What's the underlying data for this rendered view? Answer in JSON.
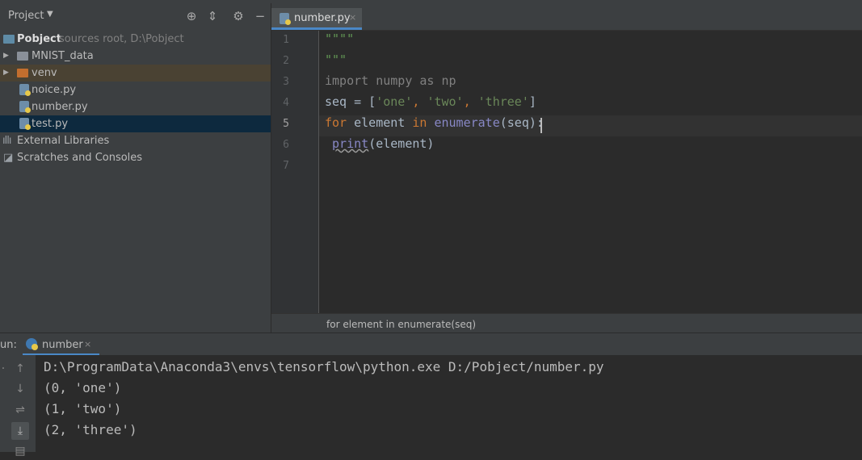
{
  "project_panel": {
    "title": "Project",
    "dropdown": "▼",
    "tree": [
      {
        "label": "Pobject",
        "hint": "sources root,  D:\\Pobject"
      },
      {
        "label": "MNIST_data"
      },
      {
        "label": "venv"
      },
      {
        "label": "noice.py"
      },
      {
        "label": "number.py"
      },
      {
        "label": "test.py"
      },
      {
        "label": "External Libraries"
      },
      {
        "label": "Scratches and Consoles"
      }
    ]
  },
  "editor": {
    "tab": {
      "label": "number.py",
      "close": "×"
    },
    "line_numbers": [
      "1",
      "2",
      "3",
      "4",
      "5",
      "6",
      "7"
    ],
    "lines": {
      "l1": "\"\"\"\"",
      "l2": "\"\"\"",
      "l3": "import numpy as np",
      "l4_a": "seq = [",
      "l4_s1": "'one'",
      "l4_c1": ", ",
      "l4_s2": "'two'",
      "l4_c2": ", ",
      "l4_s3": "'three'",
      "l4_e": "]",
      "l5_kw1": "for",
      "l5_a": " element ",
      "l5_kw2": "in",
      "l5_sp": " ",
      "l5_fn": "enumerate",
      "l5_b": "(seq):",
      "l6_sp": " ",
      "l6_fn": "print",
      "l6_b": "(element)"
    },
    "breadcrumb": "for element in enumerate(seq)"
  },
  "run_panel": {
    "label": "un:",
    "tab_label": "number",
    "tab_close": "×",
    "output": [
      "D:\\ProgramData\\Anaconda3\\envs\\tensorflow\\python.exe D:/Pobject/number.py",
      "(0, 'one')",
      "(1, 'two')",
      "(2, 'three')"
    ]
  },
  "colors": {
    "background": "#2b2b2b",
    "panel": "#3c3f41",
    "keyword": "#cc7832",
    "string": "#6a8759",
    "docstring": "#629755",
    "builtin": "#8888c6",
    "selection": "#0d293e",
    "accent": "#4a88c7"
  }
}
